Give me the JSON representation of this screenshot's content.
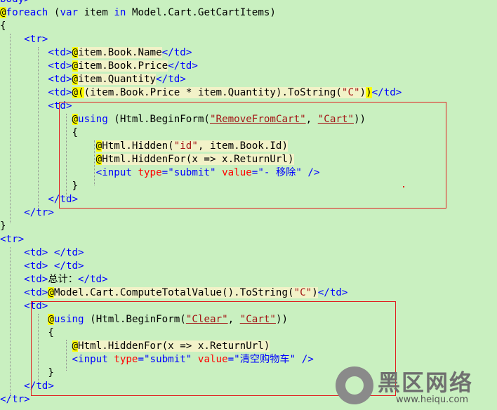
{
  "lines": [
    {
      "segments": [
        {
          "text": "body>",
          "cls": "t"
        }
      ]
    },
    {
      "segments": [
        {
          "text": "@",
          "cls": "r"
        },
        {
          "text": "foreach",
          "cls": "k"
        },
        {
          "text": " (",
          "cls": ""
        },
        {
          "text": "var",
          "cls": "k"
        },
        {
          "text": " item ",
          "cls": ""
        },
        {
          "text": "in",
          "cls": "k"
        },
        {
          "text": " Model.Cart.GetCartItems)",
          "cls": ""
        }
      ]
    },
    {
      "segments": [
        {
          "text": "{",
          "cls": ""
        }
      ]
    },
    {
      "segments": [
        {
          "text": "    ",
          "cls": ""
        },
        {
          "text": "<tr>",
          "cls": "t"
        }
      ]
    },
    {
      "segments": [
        {
          "text": "        ",
          "cls": ""
        },
        {
          "text": "<td>",
          "cls": "t"
        },
        {
          "text": "@",
          "cls": "r"
        },
        {
          "text": "item.Book.Name",
          "cls": "c"
        },
        {
          "text": "</td>",
          "cls": "t"
        }
      ]
    },
    {
      "segments": [
        {
          "text": "        ",
          "cls": ""
        },
        {
          "text": "<td>",
          "cls": "t"
        },
        {
          "text": "@",
          "cls": "r"
        },
        {
          "text": "item.Book.Price",
          "cls": "c"
        },
        {
          "text": "</td>",
          "cls": "t"
        }
      ]
    },
    {
      "segments": [
        {
          "text": "        ",
          "cls": ""
        },
        {
          "text": "<td>",
          "cls": "t"
        },
        {
          "text": "@",
          "cls": "r"
        },
        {
          "text": "item.Quantity",
          "cls": "c"
        },
        {
          "text": "</td>",
          "cls": "t"
        }
      ]
    },
    {
      "segments": [
        {
          "text": "        ",
          "cls": ""
        },
        {
          "text": "<td>",
          "cls": "t"
        },
        {
          "text": "@(",
          "cls": "r"
        },
        {
          "text": "(item.Book.Price * item.Quantity).ToString(",
          "cls": "c"
        },
        {
          "text": "\"C\"",
          "cls": "s c"
        },
        {
          "text": ")",
          "cls": "c"
        },
        {
          "text": ")",
          "cls": "r"
        },
        {
          "text": "</td>",
          "cls": "t"
        }
      ]
    },
    {
      "segments": [
        {
          "text": "        ",
          "cls": ""
        },
        {
          "text": "<td>",
          "cls": "t"
        }
      ]
    },
    {
      "segments": [
        {
          "text": "            ",
          "cls": ""
        },
        {
          "text": "@",
          "cls": "r"
        },
        {
          "text": "using",
          "cls": "k"
        },
        {
          "text": " (Html.BeginForm(",
          "cls": ""
        },
        {
          "text": "\"RemoveFromCart\"",
          "cls": "s u"
        },
        {
          "text": ", ",
          "cls": ""
        },
        {
          "text": "\"Cart\"",
          "cls": "s u"
        },
        {
          "text": "))",
          "cls": ""
        }
      ]
    },
    {
      "segments": [
        {
          "text": "            {",
          "cls": ""
        }
      ]
    },
    {
      "segments": [
        {
          "text": "                ",
          "cls": ""
        },
        {
          "text": "@",
          "cls": "r"
        },
        {
          "text": "Html.Hidden(",
          "cls": "c"
        },
        {
          "text": "\"id\"",
          "cls": "s c"
        },
        {
          "text": ", item.Book.Id)",
          "cls": "c"
        }
      ]
    },
    {
      "segments": [
        {
          "text": "                ",
          "cls": ""
        },
        {
          "text": "@",
          "cls": "r"
        },
        {
          "text": "Html.HiddenFor(x => x.ReturnUrl)",
          "cls": "c"
        }
      ]
    },
    {
      "segments": [
        {
          "text": "                ",
          "cls": ""
        },
        {
          "text": "<input",
          "cls": "t"
        },
        {
          "text": " type",
          "cls": "a"
        },
        {
          "text": "=",
          "cls": "t"
        },
        {
          "text": "\"submit\"",
          "cls": "t"
        },
        {
          "text": " value",
          "cls": "a"
        },
        {
          "text": "=",
          "cls": "t"
        },
        {
          "text": "\"- 移除\"",
          "cls": "t"
        },
        {
          "text": " />",
          "cls": "t"
        }
      ]
    },
    {
      "segments": [
        {
          "text": "            }",
          "cls": ""
        }
      ]
    },
    {
      "segments": [
        {
          "text": "        ",
          "cls": ""
        },
        {
          "text": "</td>",
          "cls": "t"
        }
      ]
    },
    {
      "segments": [
        {
          "text": "    ",
          "cls": ""
        },
        {
          "text": "</tr>",
          "cls": "t"
        }
      ]
    },
    {
      "segments": [
        {
          "text": "}",
          "cls": ""
        }
      ]
    },
    {
      "segments": [
        {
          "text": "<tr>",
          "cls": "t"
        }
      ]
    },
    {
      "segments": [
        {
          "text": "    ",
          "cls": ""
        },
        {
          "text": "<td>",
          "cls": "t"
        },
        {
          "text": " ",
          "cls": ""
        },
        {
          "text": "</td>",
          "cls": "t"
        }
      ]
    },
    {
      "segments": [
        {
          "text": "    ",
          "cls": ""
        },
        {
          "text": "<td>",
          "cls": "t"
        },
        {
          "text": " ",
          "cls": ""
        },
        {
          "text": "</td>",
          "cls": "t"
        }
      ]
    },
    {
      "segments": [
        {
          "text": "    ",
          "cls": ""
        },
        {
          "text": "<td>",
          "cls": "t"
        },
        {
          "text": "总计：",
          "cls": ""
        },
        {
          "text": "</td>",
          "cls": "t"
        }
      ]
    },
    {
      "segments": [
        {
          "text": "    ",
          "cls": ""
        },
        {
          "text": "<td>",
          "cls": "t"
        },
        {
          "text": "@",
          "cls": "r"
        },
        {
          "text": "Model.Cart.ComputeTotalValue().ToString(",
          "cls": "c"
        },
        {
          "text": "\"C\"",
          "cls": "s c"
        },
        {
          "text": ")",
          "cls": "c"
        },
        {
          "text": "</td>",
          "cls": "t"
        }
      ]
    },
    {
      "segments": [
        {
          "text": "    ",
          "cls": ""
        },
        {
          "text": "<td>",
          "cls": "t"
        }
      ]
    },
    {
      "segments": [
        {
          "text": "        ",
          "cls": ""
        },
        {
          "text": "@",
          "cls": "r"
        },
        {
          "text": "using",
          "cls": "k"
        },
        {
          "text": " (Html.BeginForm(",
          "cls": ""
        },
        {
          "text": "\"Clear\"",
          "cls": "s u"
        },
        {
          "text": ", ",
          "cls": ""
        },
        {
          "text": "\"Cart\"",
          "cls": "s u"
        },
        {
          "text": "))",
          "cls": ""
        }
      ]
    },
    {
      "segments": [
        {
          "text": "        {",
          "cls": ""
        }
      ]
    },
    {
      "segments": [
        {
          "text": "            ",
          "cls": ""
        },
        {
          "text": "@",
          "cls": "r"
        },
        {
          "text": "Html.HiddenFor(x => x.ReturnUrl)",
          "cls": "c"
        }
      ]
    },
    {
      "segments": [
        {
          "text": "            ",
          "cls": ""
        },
        {
          "text": "<input",
          "cls": "t"
        },
        {
          "text": " type",
          "cls": "a"
        },
        {
          "text": "=",
          "cls": "t"
        },
        {
          "text": "\"submit\"",
          "cls": "t"
        },
        {
          "text": " value",
          "cls": "a"
        },
        {
          "text": "=",
          "cls": "t"
        },
        {
          "text": "\"清空购物车\"",
          "cls": "t"
        },
        {
          "text": " />",
          "cls": "t"
        }
      ]
    },
    {
      "segments": [
        {
          "text": "        }",
          "cls": ""
        }
      ]
    },
    {
      "segments": [
        {
          "text": "    ",
          "cls": ""
        },
        {
          "text": "</td>",
          "cls": "t"
        }
      ]
    },
    {
      "segments": [
        {
          "text": "</tr>",
          "cls": "t"
        }
      ]
    }
  ],
  "watermark": {
    "title": "黑区网络",
    "subtitle": "www.heiqu.com"
  }
}
